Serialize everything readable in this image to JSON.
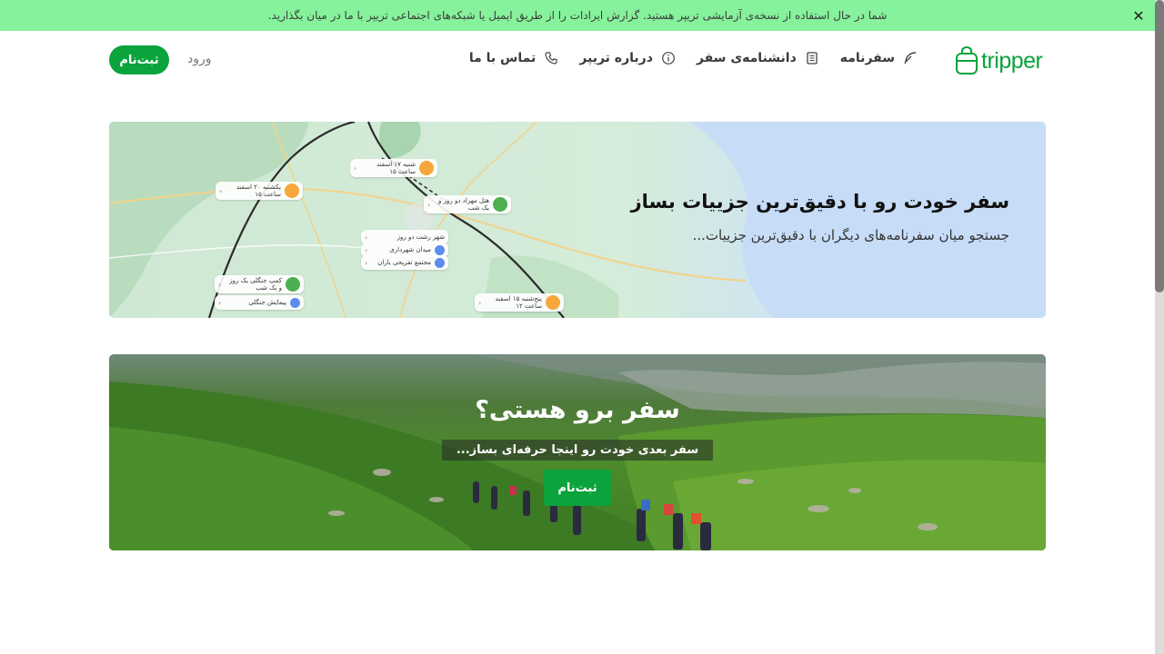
{
  "notice": {
    "text": "شما در حال استفاده از نسخه‌ی آزمایشی تریپر هستید. گزارش ایرادات را از طریق ایمیل یا شبکه‌های اجتماعی تریپر با ما در میان بگذارید.",
    "close_icon": "close-icon",
    "background": "#86f29b"
  },
  "header": {
    "logo_text": "tripper",
    "nav": [
      {
        "label": "سفرنامه",
        "icon": "feather-icon"
      },
      {
        "label": "دانشنامه‌ی سفر",
        "icon": "document-icon"
      },
      {
        "label": "درباره تریپر",
        "icon": "info-icon"
      },
      {
        "label": "تماس با ما",
        "icon": "phone-icon"
      }
    ],
    "login_label": "ورود",
    "signup_label": "ثبت‌نام"
  },
  "map_banner": {
    "title": "سفر خودت رو با دقیق‌ترین جزییات بساز",
    "subtitle": "جستجو میان سفرنامه‌های دیگران با دقیق‌ترین جزییات...",
    "pills": [
      {
        "line1": "شنبه ۱۷ اسفند",
        "line2": "ساعت ۱۵",
        "color": "#f6a73b"
      },
      {
        "line1": "یکشنبه ۲۰ اسفند",
        "line2": "ساعت ۱۵",
        "color": "#f6a73b"
      },
      {
        "line1": "هتل مهراد",
        "line2": "دو روز و یک شب",
        "color": "#4caf50"
      },
      {
        "line1": "شهر رشت",
        "line2": "دو روز",
        "color": ""
      },
      {
        "line1": "میدان شهرداری",
        "line2": "",
        "color": "#5b8def"
      },
      {
        "line1": "مجتمع تفریحی باران",
        "line2": "",
        "color": "#5b8def"
      },
      {
        "line1": "کمپ جنگلی",
        "line2": "یک روز و یک شب",
        "color": "#4caf50"
      },
      {
        "line1": "پیمایش جنگلی",
        "line2": "",
        "color": "#5b8def"
      },
      {
        "line1": "پنج‌شنبه ۱۵ اسفند",
        "line2": "ساعت ۱۲",
        "color": "#f6a73b"
      }
    ]
  },
  "hike_banner": {
    "title": "سفر برو هستی؟",
    "subtitle": "سفر بعدی خودت رو اینجا حرفه‌ای بساز...",
    "button_label": "ثبت‌نام"
  },
  "colors": {
    "brand": "#0aa33c"
  }
}
